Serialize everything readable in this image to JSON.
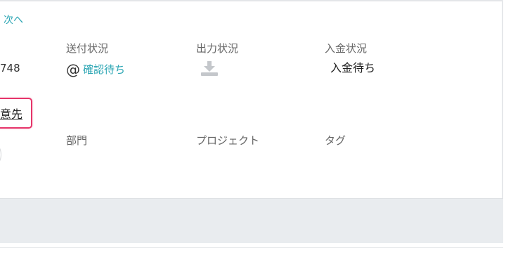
{
  "nav": {
    "next_label": "次へ"
  },
  "fields": {
    "number_fragment": "748",
    "send_status": {
      "label": "送付状況",
      "value": "確認待ち",
      "icon": "at-icon"
    },
    "output_status": {
      "label": "出力状況",
      "icon": "download-icon"
    },
    "payment_status": {
      "label": "入金状況",
      "value": "入金待ち"
    },
    "department": {
      "label": "部門"
    },
    "project": {
      "label": "プロジェクト"
    },
    "tag": {
      "label": "タグ"
    }
  },
  "priority_link": {
    "label": "意先"
  },
  "colors": {
    "accent": "#2aa5b3",
    "highlight": "#e6366b",
    "band": "#e9ecef"
  }
}
